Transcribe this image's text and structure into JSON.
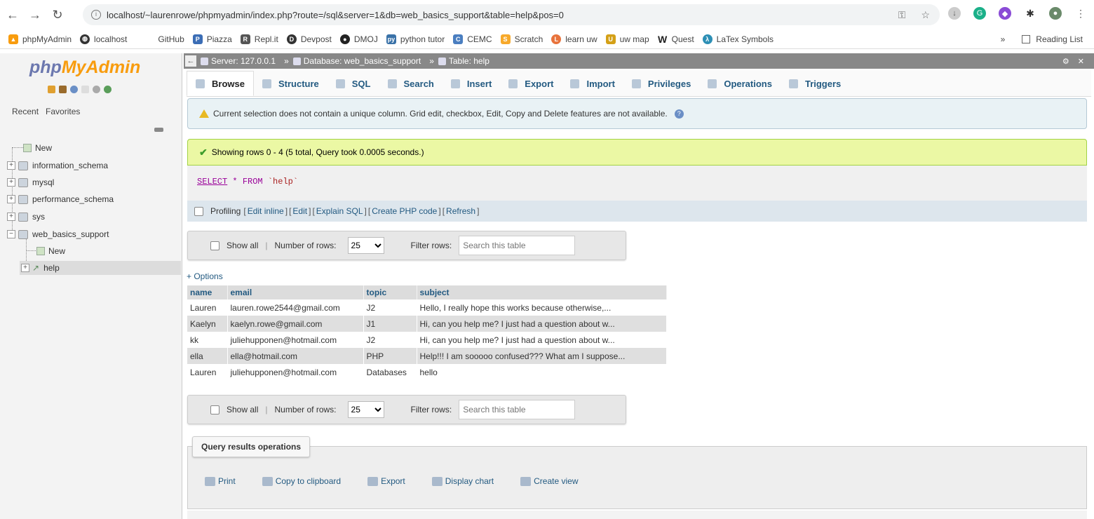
{
  "browser": {
    "url": "localhost/~laurenrowe/phpmyadmin/index.php?route=/sql&server=1&db=web_basics_support&table=help&pos=0",
    "bookmarks": [
      {
        "label": "phpMyAdmin",
        "icon": "pma-icon",
        "color": "#f89c0e"
      },
      {
        "label": "localhost",
        "icon": "globe-icon",
        "color": "#333333"
      },
      {
        "label": "GitHub",
        "icon": "",
        "color": ""
      },
      {
        "label": "Piazza",
        "icon": "piazza-icon",
        "color": "#3b6db5"
      },
      {
        "label": "Repl.it",
        "icon": "replit-icon",
        "color": "#555555"
      },
      {
        "label": "Devpost",
        "icon": "devpost-icon",
        "color": "#333333"
      },
      {
        "label": "DMOJ",
        "icon": "dmoj-icon",
        "color": "#222222"
      },
      {
        "label": "python tutor",
        "icon": "python-icon",
        "color": "#3a72a8"
      },
      {
        "label": "CEMC",
        "icon": "cemc-icon",
        "color": "#4a7ec0"
      },
      {
        "label": "Scratch",
        "icon": "scratch-icon",
        "color": "#f7a92a"
      },
      {
        "label": "learn uw",
        "icon": "learn-icon",
        "color": "#e8733c"
      },
      {
        "label": "uw map",
        "icon": "uw-icon",
        "color": "#d4a017"
      },
      {
        "label": "Quest",
        "icon": "quest-icon",
        "color": "#222222"
      },
      {
        "label": "LaTex Symbols",
        "icon": "latex-icon",
        "color": "#2d8fb5"
      }
    ],
    "more": "»",
    "reading_list": "Reading List"
  },
  "sidebar": {
    "logo_php": "php",
    "logo_my": "MyAdmin",
    "recent": "Recent",
    "favorites": "Favorites",
    "tree": {
      "new": "New",
      "db1": "information_schema",
      "db2": "mysql",
      "db3": "performance_schema",
      "db4": "sys",
      "db5": "web_basics_support",
      "db5_new": "New",
      "db5_help": "help"
    }
  },
  "breadcrumb": {
    "server": "Server: 127.0.0.1",
    "database": "Database: web_basics_support",
    "table": "Table: help"
  },
  "tabs": {
    "browse": "Browse",
    "structure": "Structure",
    "sql": "SQL",
    "search": "Search",
    "insert": "Insert",
    "export": "Export",
    "import": "Import",
    "privileges": "Privileges",
    "operations": "Operations",
    "triggers": "Triggers"
  },
  "notice": "Current selection does not contain a unique column. Grid edit, checkbox, Edit, Copy and Delete features are not available.",
  "success": "Showing rows 0 - 4 (5 total, Query took 0.0005 seconds.)",
  "sql": {
    "select": "SELECT",
    "star": "*",
    "from": "FROM",
    "table": "`help`"
  },
  "profiling": {
    "label": "Profiling",
    "edit_inline": "Edit inline",
    "edit": "Edit",
    "explain": "Explain SQL",
    "create_php": "Create PHP code",
    "refresh": "Refresh"
  },
  "nav": {
    "show_all": "Show all",
    "num_rows_label": "Number of rows:",
    "num_rows": "25",
    "filter_label": "Filter rows:",
    "filter_placeholder": "Search this table"
  },
  "options": "+ Options",
  "table": {
    "headers": [
      "name",
      "email",
      "topic",
      "subject"
    ],
    "rows": [
      [
        "Lauren",
        "lauren.rowe2544@gmail.com",
        "J2",
        "Hello, I really hope this works because otherwise,..."
      ],
      [
        "Kaelyn",
        "kaelyn.rowe@gmail.com",
        "J1",
        "Hi, can you help me? I just had a question about w..."
      ],
      [
        "kk",
        "juliehupponen@hotmail.com",
        "J2",
        "Hi, can you help me? I just had a question about w..."
      ],
      [
        "ella",
        "ella@hotmail.com",
        "PHP",
        "Help!!! I am sooooo confused??? What am I suppose..."
      ],
      [
        "Lauren",
        "juliehupponen@hotmail.com",
        "Databases",
        "hello"
      ]
    ]
  },
  "qro": {
    "title": "Query results operations",
    "print": "Print",
    "copy": "Copy to clipboard",
    "export": "Export",
    "chart": "Display chart",
    "view": "Create view"
  }
}
